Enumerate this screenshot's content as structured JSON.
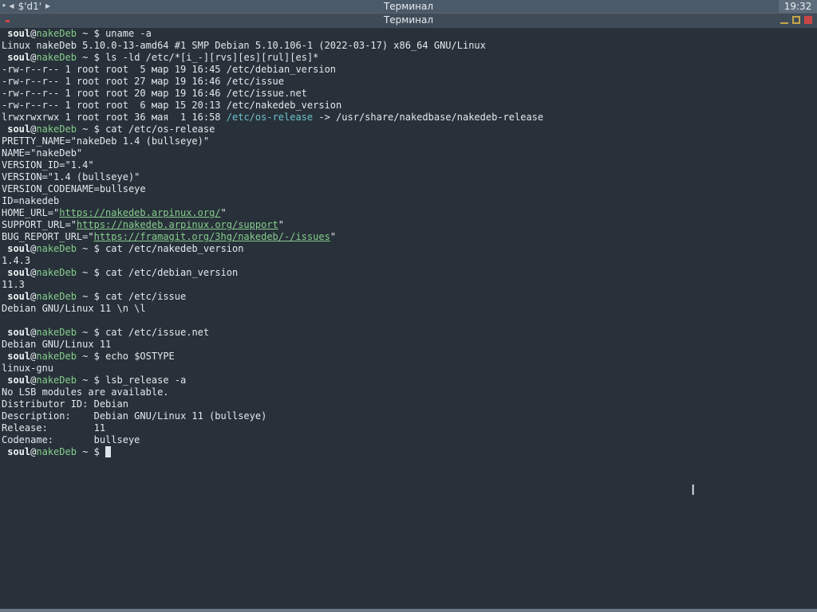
{
  "panel": {
    "workspace_prev": "⯈",
    "workspace_left": "◀",
    "workspace_label": "$'d1'",
    "workspace_right": "▶",
    "title": "Терминал",
    "clock": "19:32"
  },
  "window": {
    "title": "Терминал"
  },
  "prompt": {
    "user": "soul",
    "at": "@",
    "host": "nakeDeb",
    "tail": " ~ $ "
  },
  "term": {
    "cmd_uname": "uname -a",
    "out_uname": "Linux nakeDeb 5.10.0-13-amd64 #1 SMP Debian 5.10.106-1 (2022-03-17) x86_64 GNU/Linux",
    "cmd_ls": "ls -ld /etc/*[i_-][rvs][es][rul][es]*",
    "ls": [
      "-rw-r--r-- 1 root root  5 мар 19 16:45 /etc/debian_version",
      "-rw-r--r-- 1 root root 27 мар 19 16:46 /etc/issue",
      "-rw-r--r-- 1 root root 20 мар 19 16:46 /etc/issue.net",
      "-rw-r--r-- 1 root root  6 мар 15 20:13 /etc/nakedeb_version"
    ],
    "ls_link_prefix": "lrwxrwxrwx 1 root root 36 мая  1 16:58 ",
    "ls_link_name": "/etc/os-release",
    "ls_link_target": " -> /usr/share/nakedbase/nakedeb-release",
    "cmd_osrel": "cat /etc/os-release",
    "osrel": [
      "PRETTY_NAME=\"nakeDeb 1.4 (bullseye)\"",
      "NAME=\"nakeDeb\"",
      "VERSION_ID=\"1.4\"",
      "VERSION=\"1.4 (bullseye)\"",
      "VERSION_CODENAME=bullseye",
      "ID=nakedeb"
    ],
    "home_key": "HOME_URL=\"",
    "home_url": "https://nakedeb.arpinux.org/",
    "support_key": "SUPPORT_URL=\"",
    "support_url": "https://nakedeb.arpinux.org/support",
    "bug_key": "BUG_REPORT_URL=\"",
    "bug_url": "https://framagit.org/3hg/nakedeb/-/issues",
    "quote": "\"",
    "cmd_nakever": "cat /etc/nakedeb_version",
    "out_nakever": "1.4.3",
    "cmd_debver": "cat /etc/debian_version",
    "out_debver": "11.3",
    "cmd_issue": "cat /etc/issue",
    "out_issue": "Debian GNU/Linux 11 \\n \\l",
    "cmd_issuenet": "cat /etc/issue.net",
    "out_issuenet": "Debian GNU/Linux 11",
    "cmd_echo": "echo $OSTYPE",
    "out_echo": "linux-gnu",
    "cmd_lsb": "lsb_release -a",
    "lsb": [
      "No LSB modules are available.",
      "Distributor ID: Debian",
      "Description:    Debian GNU/Linux 11 (bullseye)",
      "Release:        11",
      "Codename:       bullseye"
    ]
  },
  "colors": {
    "background": "#283139",
    "host": "#86cc8d",
    "link": "#86cc8d",
    "symlink": "#6fc1d0"
  }
}
